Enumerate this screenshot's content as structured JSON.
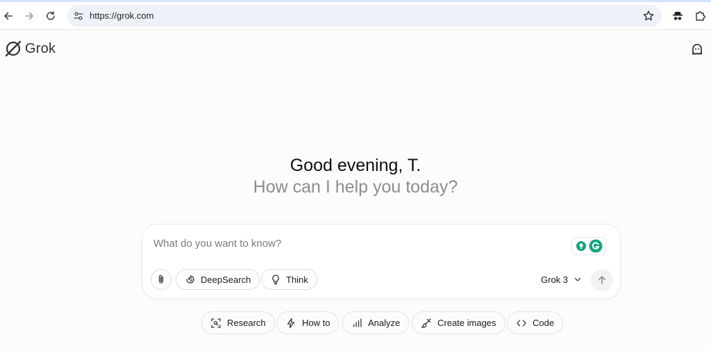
{
  "browser": {
    "url": "https://grok.com",
    "icons": [
      "back-icon",
      "forward-icon",
      "reload-icon",
      "site-info-icon",
      "bookmark-star-icon",
      "incognito-spy-icon",
      "extensions-puzzle-icon"
    ]
  },
  "app": {
    "logo_text": "Grok",
    "ghost_icon": "ghost-icon"
  },
  "greeting": {
    "title": "Good evening, T.",
    "subtitle": "How can I help you today?"
  },
  "composer": {
    "placeholder": "What do you want to know?",
    "deepsearch_label": "DeepSearch",
    "think_label": "Think",
    "model_label": "Grok 3"
  },
  "suggestions": [
    {
      "label": "Research",
      "icon": "research-icon"
    },
    {
      "label": "How to",
      "icon": "lightning-icon"
    },
    {
      "label": "Analyze",
      "icon": "bar-chart-icon"
    },
    {
      "label": "Create images",
      "icon": "paintbrush-icon"
    },
    {
      "label": "Code",
      "icon": "code-brackets-icon"
    }
  ],
  "colors": {
    "page_bg": "#fcfcfb",
    "muted_text": "#8a8d91",
    "grammarly_green": "#15a37f"
  }
}
